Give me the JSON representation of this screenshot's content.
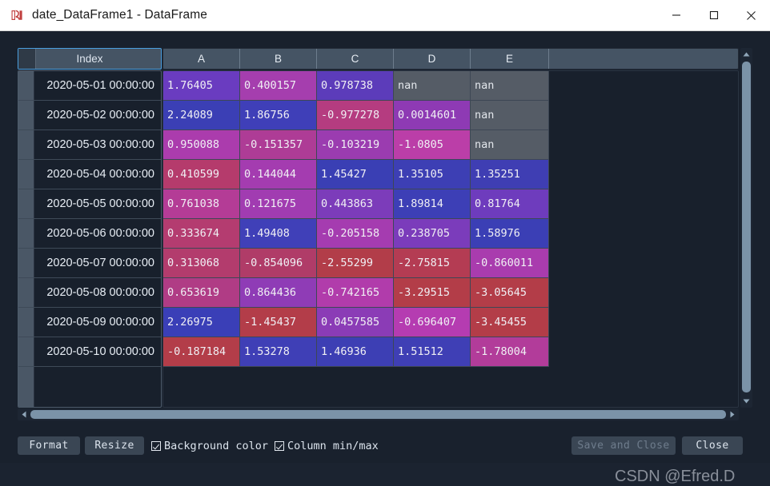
{
  "window": {
    "title": "date_DataFrame1 - DataFrame",
    "icon": "spyder-variable-icon",
    "controls": [
      {
        "name": "minimize-button",
        "glyph": "minimize-icon"
      },
      {
        "name": "maximize-button",
        "glyph": "maximize-icon"
      },
      {
        "name": "close-button",
        "glyph": "close-icon"
      }
    ]
  },
  "table": {
    "index_header": "Index",
    "columns": [
      "A",
      "B",
      "C",
      "D",
      "E"
    ],
    "index": [
      "2020-05-01 00:00:00",
      "2020-05-02 00:00:00",
      "2020-05-03 00:00:00",
      "2020-05-04 00:00:00",
      "2020-05-05 00:00:00",
      "2020-05-06 00:00:00",
      "2020-05-07 00:00:00",
      "2020-05-08 00:00:00",
      "2020-05-09 00:00:00",
      "2020-05-10 00:00:00"
    ],
    "rows": [
      [
        {
          "text": "1.76405",
          "bg": "#6a3cc0"
        },
        {
          "text": "0.400157",
          "bg": "#a53eae"
        },
        {
          "text": "0.978738",
          "bg": "#5c3cba"
        },
        {
          "text": "nan",
          "bg": "#555c66"
        },
        {
          "text": "nan",
          "bg": "#555c66"
        }
      ],
      [
        {
          "text": "2.24089",
          "bg": "#3b3fb5"
        },
        {
          "text": "1.86756",
          "bg": "#3f3fb8"
        },
        {
          "text": "-0.977278",
          "bg": "#b53c80"
        },
        {
          "text": "0.0014601",
          "bg": "#8e3ab4"
        },
        {
          "text": "nan",
          "bg": "#555c66"
        }
      ],
      [
        {
          "text": "0.950088",
          "bg": "#ab3cad"
        },
        {
          "text": "-0.151357",
          "bg": "#ae3c96"
        },
        {
          "text": "-0.103219",
          "bg": "#9b3cb0"
        },
        {
          "text": "-1.0805",
          "bg": "#bb3ea8"
        },
        {
          "text": "nan",
          "bg": "#555c66"
        }
      ],
      [
        {
          "text": "0.410599",
          "bg": "#b53b6c"
        },
        {
          "text": "0.144044",
          "bg": "#a43cb0"
        },
        {
          "text": "1.45427",
          "bg": "#3a3fb4"
        },
        {
          "text": "1.35105",
          "bg": "#3d3fb4"
        },
        {
          "text": "1.35251",
          "bg": "#3f3eb3"
        }
      ],
      [
        {
          "text": "0.761038",
          "bg": "#b43c96"
        },
        {
          "text": "0.121675",
          "bg": "#a13cb1"
        },
        {
          "text": "0.443863",
          "bg": "#7c3cba"
        },
        {
          "text": "1.89814",
          "bg": "#3d3fb6"
        },
        {
          "text": "0.81764",
          "bg": "#6e3cbd"
        }
      ],
      [
        {
          "text": "0.333674",
          "bg": "#b43c70"
        },
        {
          "text": "1.49408",
          "bg": "#4040b8"
        },
        {
          "text": "-0.205158",
          "bg": "#a53cb0"
        },
        {
          "text": "0.238705",
          "bg": "#7b3cbb"
        },
        {
          "text": "1.58976",
          "bg": "#3b3fb5"
        }
      ],
      [
        {
          "text": "0.313068",
          "bg": "#b33c6d"
        },
        {
          "text": "-0.854096",
          "bg": "#b03c68"
        },
        {
          "text": "-2.55299",
          "bg": "#b23d49"
        },
        {
          "text": "-2.75815",
          "bg": "#b43c53"
        },
        {
          "text": "-0.860011",
          "bg": "#a93cae"
        }
      ],
      [
        {
          "text": "0.653619",
          "bg": "#b03c85"
        },
        {
          "text": "0.864436",
          "bg": "#8f3cb6"
        },
        {
          "text": "-0.742165",
          "bg": "#b13cab"
        },
        {
          "text": "-3.29515",
          "bg": "#b33d48"
        },
        {
          "text": "-3.05645",
          "bg": "#b33d48"
        }
      ],
      [
        {
          "text": "2.26975",
          "bg": "#3a3fb7"
        },
        {
          "text": "-1.45437",
          "bg": "#b33d49"
        },
        {
          "text": "0.0457585",
          "bg": "#8b3cb6"
        },
        {
          "text": "-0.696407",
          "bg": "#b53cb1"
        },
        {
          "text": "-3.45455",
          "bg": "#b33d48"
        }
      ],
      [
        {
          "text": "-0.187184",
          "bg": "#b33d49"
        },
        {
          "text": "1.53278",
          "bg": "#3f3fb6"
        },
        {
          "text": "1.46936",
          "bg": "#3d3fb4"
        },
        {
          "text": "1.51512",
          "bg": "#3f3fb5"
        },
        {
          "text": "-1.78004",
          "bg": "#b23c9a"
        }
      ]
    ],
    "empty_row_count": 2
  },
  "footer": {
    "format_button": "Format",
    "resize_button": "Resize",
    "background_color_checkbox": {
      "label": "Background color",
      "checked": true
    },
    "column_minmax_checkbox": {
      "label": "Column min/max",
      "checked": true
    },
    "save_and_close_button": {
      "label": "Save and Close",
      "enabled": false
    },
    "close_button": {
      "label": "Close",
      "enabled": true
    }
  },
  "watermark": "CSDN @Efred.D",
  "colors": {
    "titlebar_bg": "#ffffff",
    "window_bg": "#19212d",
    "header_bg": "#455464",
    "index_gutter": "#4a5766",
    "selection_border": "#4a9fe0",
    "nan_bg": "#555c66",
    "scrollbar_thumb": "#7b93a8",
    "button_bg": "#3a4654"
  }
}
